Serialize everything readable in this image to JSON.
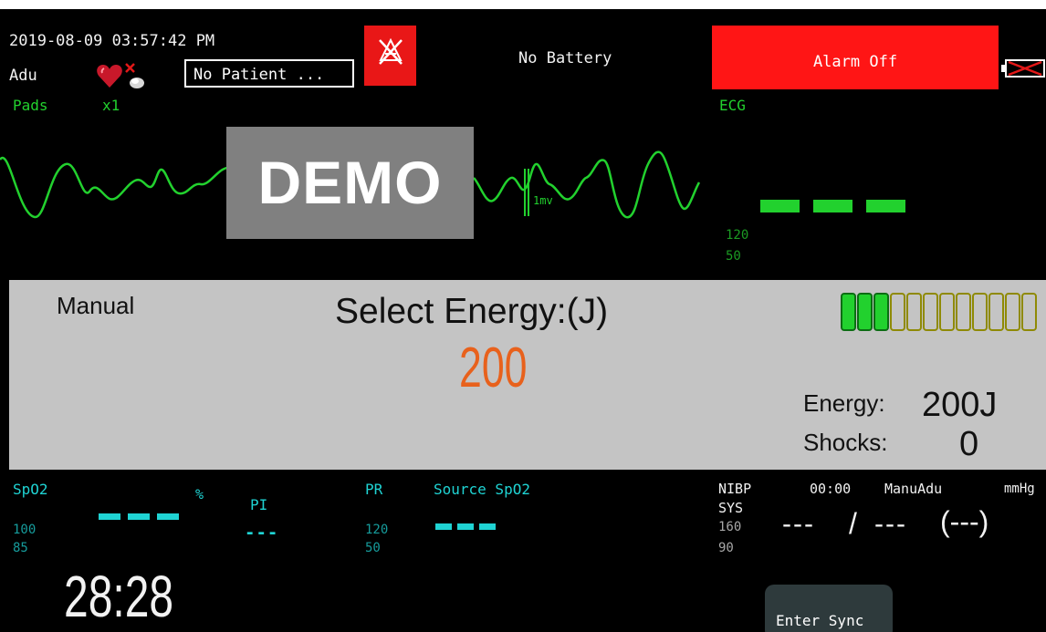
{
  "header": {
    "datetime": "2019-08-09 03:57:42 PM",
    "patient_type": "Adu",
    "patient_button": "No Patient ...",
    "battery_status": "No Battery",
    "alarm_status": "Alarm Off"
  },
  "icons": {
    "heart": "heart-off-icon",
    "alarm_silence": "alarm-silenced-icon",
    "battery": "battery-missing-icon"
  },
  "ecg_left": {
    "lead": "Pads",
    "gain": "x1",
    "watermark": "DEMO",
    "scale_label": "1mv"
  },
  "ecg_panel": {
    "label": "ECG",
    "hr_value": "---",
    "upper_limit": "120",
    "lower_limit": "50"
  },
  "therapy": {
    "mode": "Manual",
    "prompt": "Select Energy:(J)",
    "selected_energy": "200",
    "energy_label": "Energy:",
    "energy_value": "200J",
    "shocks_label": "Shocks:",
    "shocks_value": "0",
    "charge_level": 0.25
  },
  "spo2": {
    "label": "SpO2",
    "unit": "%",
    "value": "---",
    "upper_limit": "100",
    "lower_limit": "85",
    "pi_label": "PI",
    "pi_value": "---"
  },
  "pr": {
    "label": "PR",
    "source": "Source SpO2",
    "value": "---",
    "upper_limit": "120",
    "lower_limit": "50"
  },
  "nibp": {
    "label": "NIBP",
    "time": "00:00",
    "mode": "ManuAdu",
    "unit": "mmHg",
    "sys_label": "SYS",
    "upper_limit": "160",
    "lower_limit": "90",
    "systolic": "---",
    "separator": "/",
    "diastolic": "---",
    "mean": "(---)"
  },
  "timer": "28:28",
  "buttons": {
    "enter_sync": "Enter Sync"
  },
  "colors": {
    "background": "#000000",
    "alarm_red": "#ff1515",
    "ecg_green": "#22d12e",
    "spo2_cyan": "#1fd3d3",
    "energy_orange": "#e8611c",
    "therapy_gray": "#c4c4c4",
    "charge_olive": "#8f8a05"
  }
}
